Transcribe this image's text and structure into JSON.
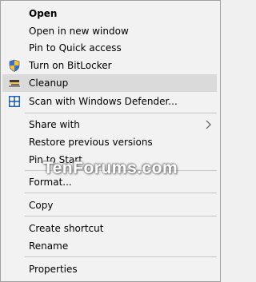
{
  "menu": {
    "items": [
      {
        "label": "Open"
      },
      {
        "label": "Open in new window"
      },
      {
        "label": "Pin to Quick access"
      },
      {
        "label": "Turn on BitLocker",
        "icon": "uac-shield-icon"
      },
      {
        "label": "Cleanup",
        "icon": "disk-cleanup-icon"
      },
      {
        "label": "Scan with Windows Defender...",
        "icon": "windows-defender-icon"
      },
      {
        "label": "Share with",
        "submenu": "chevron-right-icon"
      },
      {
        "label": "Restore previous versions"
      },
      {
        "label": "Pin to Start"
      },
      {
        "label": "Format..."
      },
      {
        "label": "Copy"
      },
      {
        "label": "Create shortcut"
      },
      {
        "label": "Rename"
      },
      {
        "label": "Properties"
      }
    ],
    "highlighted_item": "Cleanup"
  },
  "watermark": {
    "text": "TenForums.com"
  },
  "colors": {
    "menu_background": "#f2f2f2",
    "highlight": "#dadada",
    "separator": "#c8c8c8",
    "border": "#a0a0a0"
  }
}
